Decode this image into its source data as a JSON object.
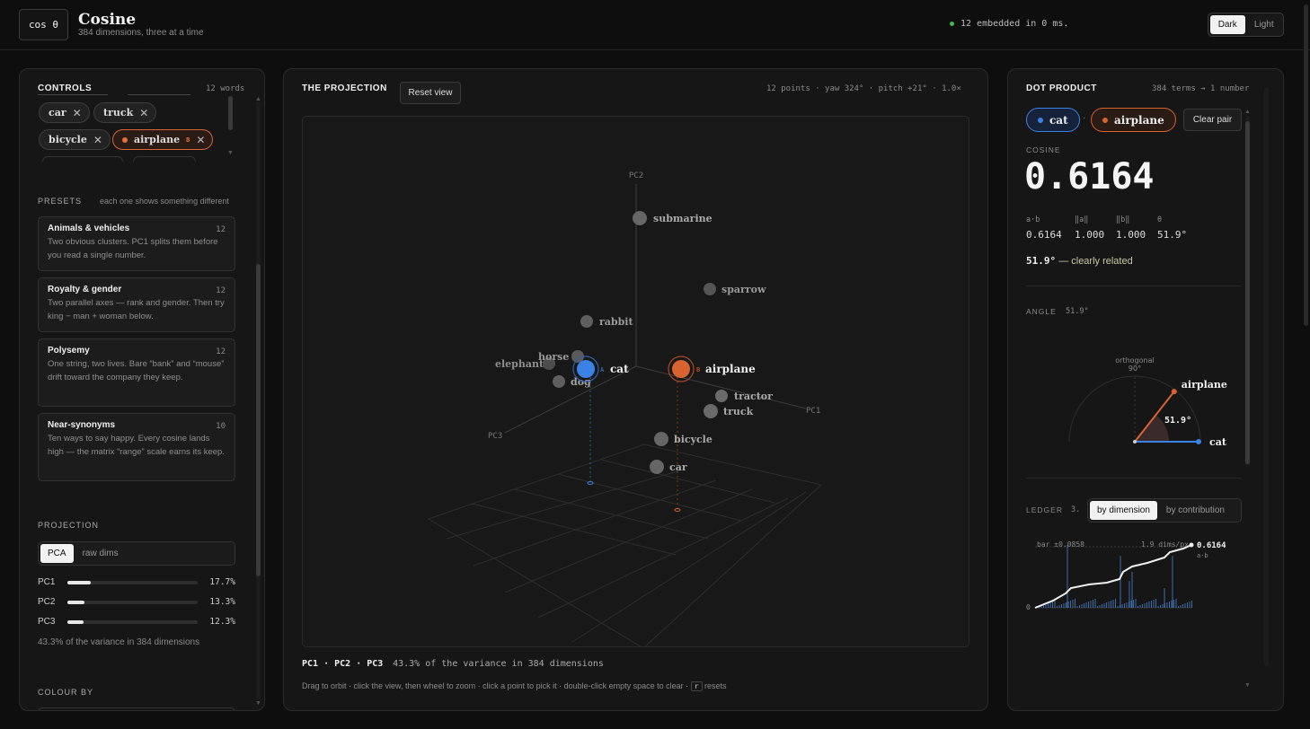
{
  "header": {
    "logo": "cos θ",
    "title": "Cosine",
    "subtitle": "384 dimensions, three at a time",
    "status": "12 embedded in 0 ms.",
    "theme_dark": "Dark",
    "theme_light": "Light"
  },
  "controls": {
    "title": "CONTROLS",
    "count": "12 words",
    "chips": [
      {
        "label": "car"
      },
      {
        "label": "truck"
      },
      {
        "label": "bicycle"
      },
      {
        "label": "airplane",
        "tag": "B"
      }
    ],
    "presets_title": "PRESETS",
    "presets_note": "each one shows something different",
    "presets": [
      {
        "title": "Animals & vehicles",
        "count": "12",
        "desc": "Two obvious clusters. PC1 splits them before you read a single number."
      },
      {
        "title": "Royalty & gender",
        "count": "12",
        "desc": "Two parallel axes — rank and gender. Then try king − man + woman below."
      },
      {
        "title": "Polysemy",
        "count": "12",
        "desc": "One string, two lives. Bare “bank” and “mouse” drift toward the company they keep."
      },
      {
        "title": "Near-synonyms",
        "count": "10",
        "desc": "Ten ways to say happy. Every cosine lands high — the matrix “range” scale earns its keep."
      }
    ],
    "projection_title": "PROJECTION",
    "projection_modes": [
      "PCA",
      "raw dims"
    ],
    "pcs": [
      {
        "label": "PC1",
        "value": "17.7%",
        "pct": 17.7
      },
      {
        "label": "PC2",
        "value": "13.3%",
        "pct": 13.3
      },
      {
        "label": "PC3",
        "value": "12.3%",
        "pct": 12.3
      }
    ],
    "variance_note": "43.3% of the variance in 384 dimensions",
    "colour_by_title": "COLOUR BY"
  },
  "projection": {
    "title": "THE PROJECTION",
    "reset_label": "Reset view",
    "info": "12 points · yaw 324° · pitch +21° · 1.0×",
    "axes": [
      "PC1",
      "PC2",
      "PC3"
    ],
    "points": [
      {
        "label": "submarine"
      },
      {
        "label": "sparrow"
      },
      {
        "label": "rabbit"
      },
      {
        "label": "horse"
      },
      {
        "label": "elephant"
      },
      {
        "label": "cat",
        "tag": "A"
      },
      {
        "label": "dog"
      },
      {
        "label": "airplane",
        "tag": "B"
      },
      {
        "label": "tractor"
      },
      {
        "label": "truck"
      },
      {
        "label": "bicycle"
      },
      {
        "label": "car"
      }
    ],
    "footer_axes": "PC1 · PC2 · PC3",
    "footer_variance": "43.3% of the variance in 384 dimensions",
    "hint": "Drag to orbit · click the view, then wheel to zoom · click a point to pick it · double-click empty space to clear ·",
    "hint_key": "r",
    "hint_end": "resets"
  },
  "dot_product": {
    "title": "DOT PRODUCT",
    "note": "384 terms → 1 number",
    "pair_a": "cat",
    "pair_b": "airplane",
    "pair_sep": "·",
    "clear_label": "Clear pair",
    "cosine_label": "COSINE",
    "cosine_value": "0.6164",
    "stats": [
      {
        "head": "a·b",
        "value": "0.6164"
      },
      {
        "head": "‖a‖",
        "value": "1.000"
      },
      {
        "head": "‖b‖",
        "value": "1.000"
      },
      {
        "head": "θ",
        "value": "51.9°"
      }
    ],
    "verdict_angle": "51.9°",
    "verdict_text": "— clearly related",
    "angle_title": "ANGLE",
    "angle_value": "51.9°",
    "angle_deg": 51.9,
    "orthogonal_label": "orthogonal",
    "orthogonal_deg": "90°",
    "angle_label_a": "cat",
    "angle_label_b": "airplane",
    "ledger_title": "LEDGER",
    "ledger_num": "3.",
    "ledger_modes": [
      "by dimension",
      "by contribution"
    ],
    "ledger_bar_note": "bar ±0.0858",
    "ledger_dims_note": "1.9 dims/px",
    "ledger_end_value": "0.6164",
    "ledger_end_label": "a·b",
    "ledger_zero": "0"
  },
  "colors": {
    "a": "#3b82e6",
    "b": "#d9632f",
    "green": "#3fb950"
  }
}
